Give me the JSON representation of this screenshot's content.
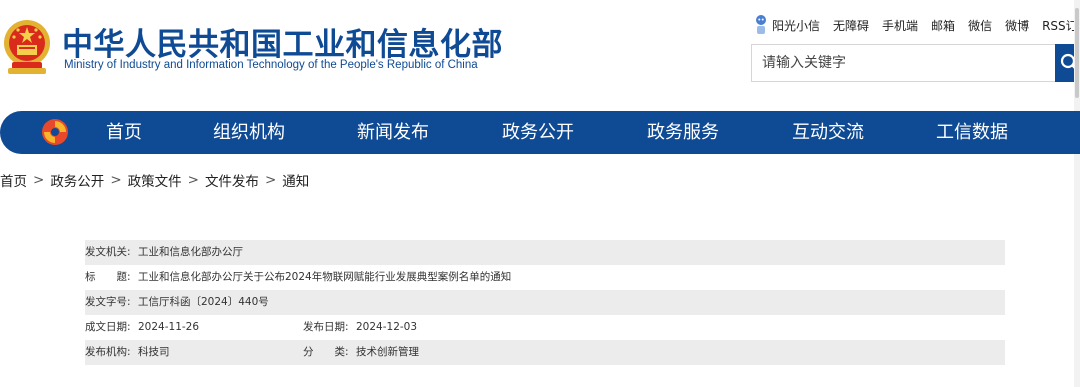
{
  "header": {
    "title_cn": "中华人民共和国工业和信息化部",
    "title_en": "Ministry of Industry and Information Technology of the People's Republic of China"
  },
  "toplinks": [
    "阳光小信",
    "无障碍",
    "手机端",
    "邮箱",
    "微信",
    "微博",
    "RSS订"
  ],
  "search": {
    "placeholder": "请输入关键字"
  },
  "nav": [
    "首页",
    "组织机构",
    "新闻发布",
    "政务公开",
    "政务服务",
    "互动交流",
    "工信数据"
  ],
  "breadcrumb": {
    "items": [
      "首页",
      "政务公开",
      "政策文件",
      "文件发布",
      "通知"
    ],
    "separator": ">"
  },
  "info": {
    "issuer_label": "发文机关:",
    "issuer": "工业和信息化部办公厅",
    "title_label": "标　　题:",
    "title": "工业和信息化部办公厅关于公布2024年物联网赋能行业发展典型案例名单的通知",
    "docno_label": "发文字号:",
    "docno": "工信厅科函〔2024〕440号",
    "created_label": "成文日期:",
    "created": "2024-11-26",
    "published_label": "发布日期:",
    "published": "2024-12-03",
    "org_label": "发布机构:",
    "org": "科技司",
    "category_label": "分　　类:",
    "category": "技术创新管理"
  },
  "colors": {
    "brand_blue": "#0f4a94",
    "row_shade": "#ececec"
  }
}
